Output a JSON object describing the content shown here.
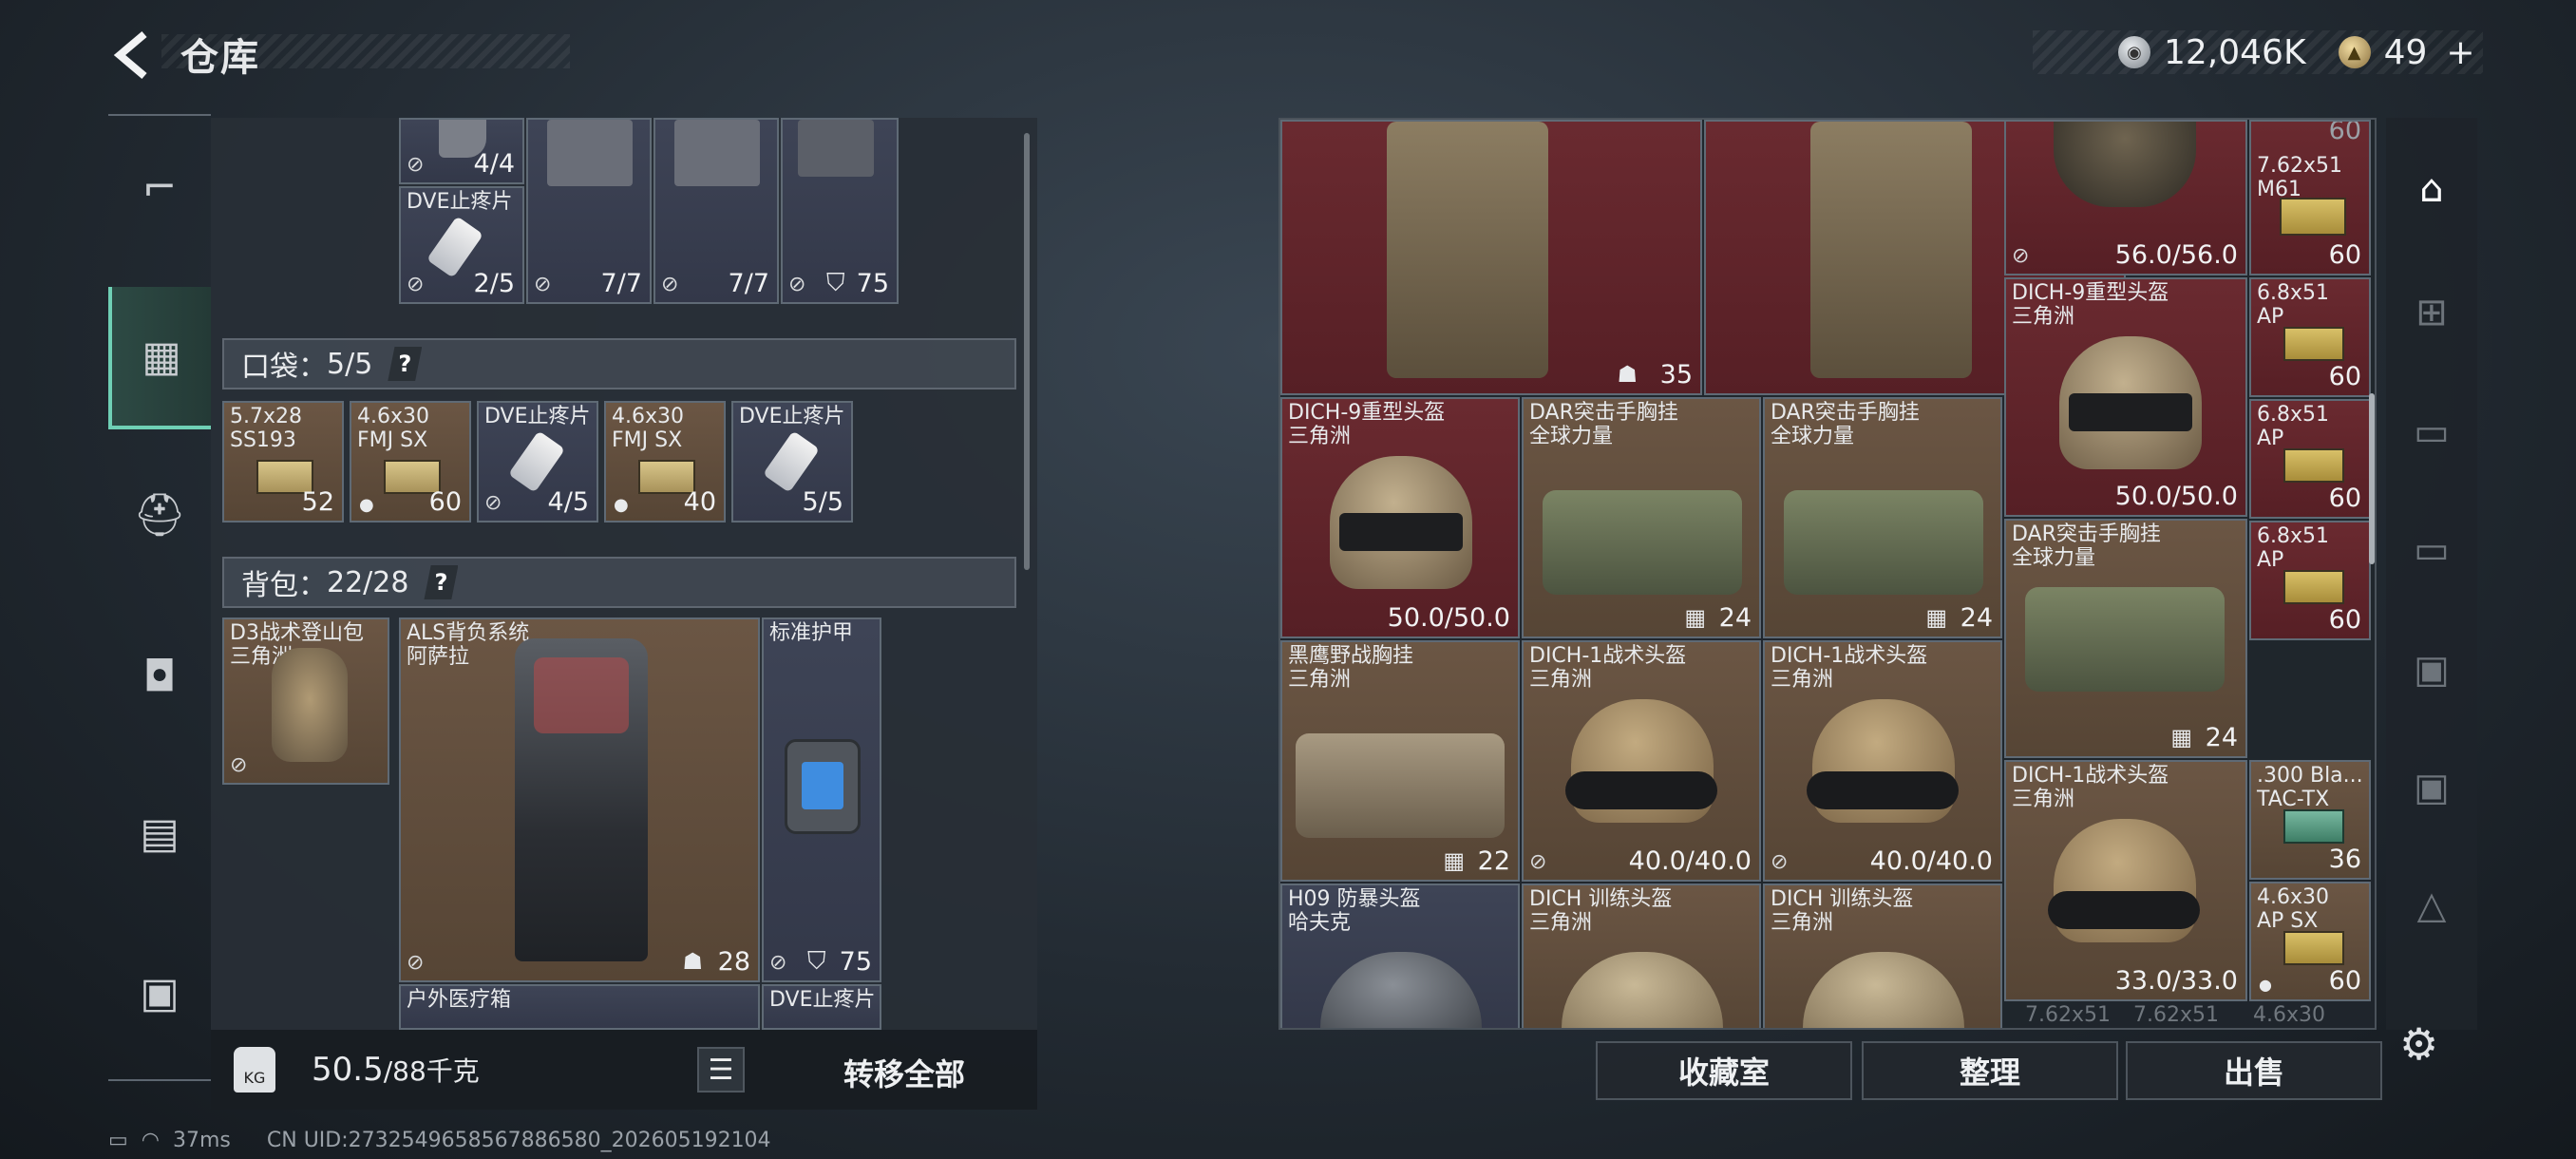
{
  "topbar": {
    "title": "仓库"
  },
  "currency": {
    "silver": "12,046K",
    "gold": "49",
    "gold_plus": "+"
  },
  "pocket": {
    "label": "口袋",
    "count": "5/5",
    "help": "?"
  },
  "backpack": {
    "label": "背包",
    "count": "22/28",
    "help": "?"
  },
  "left_top_counts": [
    "4/4",
    "2/5",
    "7/7",
    "7/7",
    "75"
  ],
  "left_top_name": "DVE止疼片",
  "pocket_items": [
    {
      "name": "5.7x28\nSS193",
      "count": "52"
    },
    {
      "name": "4.6x30\nFMJ SX",
      "count": "60"
    },
    {
      "name": "DVE止疼片",
      "count": "4/5"
    },
    {
      "name": "4.6x30\nFMJ SX",
      "count": "40"
    },
    {
      "name": "DVE止疼片",
      "count": "5/5"
    }
  ],
  "backpack_items": [
    {
      "name": "D3战术登山包\n三角洲",
      "count": ""
    },
    {
      "name": "ALS背负系统\n阿萨拉",
      "count": "28"
    },
    {
      "name": "标准护甲",
      "count": "75"
    },
    {
      "name": "户外医疗箱",
      "count": ""
    },
    {
      "name": "DVE止疼片",
      "count": ""
    }
  ],
  "weight": {
    "value": "50.5",
    "max": "/88千克",
    "bag_icon_label": "KG"
  },
  "transfer_all": "转移全部",
  "status": {
    "ping": "37ms",
    "uid": "CN UID:2732549658567886580_202605192104"
  },
  "right_items": {
    "chest_rig_count_1": "35",
    "chest_rig_count_2": "35",
    "helmet_top_count": "56.0/56.0",
    "ammo_top_name": "7.62x51\nM61",
    "ammo_top_count_a": "60",
    "ammo_top_count_b": "60",
    "dich9_name_right": "DICH-9重型头盔\n三角洲",
    "dich9_count_right": "50.0/50.0",
    "ammo2_name": "6.8x51\nAP",
    "ammo2_count": "60",
    "dich9_name_left": "DICH-9重型头盔\n三角洲",
    "dich9_count_left": "50.0/50.0",
    "dar1_name": "DAR突击手胸挂\n全球力量",
    "dar1_count": "24",
    "dar2_name": "DAR突击手胸挂\n全球力量",
    "dar2_count": "24",
    "ammo3_name": "6.8x51\nAP",
    "ammo3_count": "60",
    "dar3_name": "DAR突击手胸挂\n全球力量",
    "dar3_count": "24",
    "ammo4_name": "6.8x51\nAP",
    "ammo4_count": "60",
    "blackeagle_name": "黑鹰野战胸挂\n三角洲",
    "blackeagle_count": "22",
    "dich1a_name": "DICH-1战术头盔\n三角洲",
    "dich1a_count": "40.0/40.0",
    "dich1b_name": "DICH-1战术头盔\n三角洲",
    "dich1b_count": "40.0/40.0",
    "dich1c_name": "DICH-1战术头盔\n三角洲",
    "dich1c_count": "33.0/33.0",
    "ammo5_name": ".300 Bla...\nTAC-TX",
    "ammo5_count": "36",
    "h09_name": "H09 防暴头盔\n哈夫克",
    "dich_train1_name": "DICH 训练头盔\n三角洲",
    "dich_train2_name": "DICH 训练头盔\n三角洲",
    "ammo6_name": "4.6x30\nAP SX",
    "ammo6_count": "60",
    "bottom_labels": [
      "7.62x51",
      "7.62x51",
      "4.6x30"
    ]
  },
  "right_buttons": {
    "collection": "收藏室",
    "organize": "整理",
    "sell": "出售"
  },
  "colors": {
    "accent": "#6fd0b5",
    "red_slot": "#5e2128",
    "gold_slot": "#5d4a3a"
  }
}
